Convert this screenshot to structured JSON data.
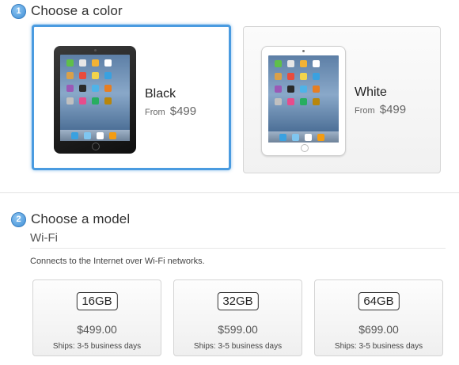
{
  "step1": {
    "number": "1",
    "title": "Choose a color"
  },
  "colors": [
    {
      "name": "Black",
      "from_label": "From",
      "price": "$499",
      "selected": true
    },
    {
      "name": "White",
      "from_label": "From",
      "price": "$499",
      "selected": false
    }
  ],
  "step2": {
    "number": "2",
    "title": "Choose a model"
  },
  "connectivity": {
    "title": "Wi-Fi",
    "description": "Connects to the Internet over Wi-Fi networks."
  },
  "models": [
    {
      "capacity": "16GB",
      "price": "$499.00",
      "shipping": "Ships: 3-5 business days"
    },
    {
      "capacity": "32GB",
      "price": "$599.00",
      "shipping": "Ships: 3-5 business days"
    },
    {
      "capacity": "64GB",
      "price": "$699.00",
      "shipping": "Ships: 3-5 business days"
    }
  ],
  "accent_color": "#4a9be0"
}
